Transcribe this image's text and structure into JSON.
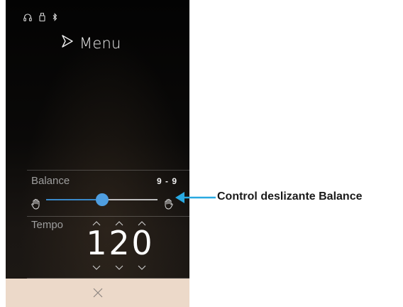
{
  "menu": {
    "label": "Menu",
    "icon": "menu-play-icon"
  },
  "status_icons": [
    "headphones-icon",
    "usb-icon",
    "bluetooth-icon"
  ],
  "balance": {
    "label": "Balance",
    "value": "9 - 9",
    "slider_fraction": 0.5,
    "accent_color": "#4f9ee0",
    "left_icon": "hand-left-icon",
    "right_icon": "hand-right-icon"
  },
  "tempo": {
    "label": "Tempo",
    "digits": [
      "1",
      "2",
      "0"
    ]
  },
  "close": {
    "icon": "close-icon",
    "bar_color": "#ecd9c9"
  },
  "callout": {
    "text": "Control deslizante Balance",
    "arrow_color": "#29a9e1"
  }
}
